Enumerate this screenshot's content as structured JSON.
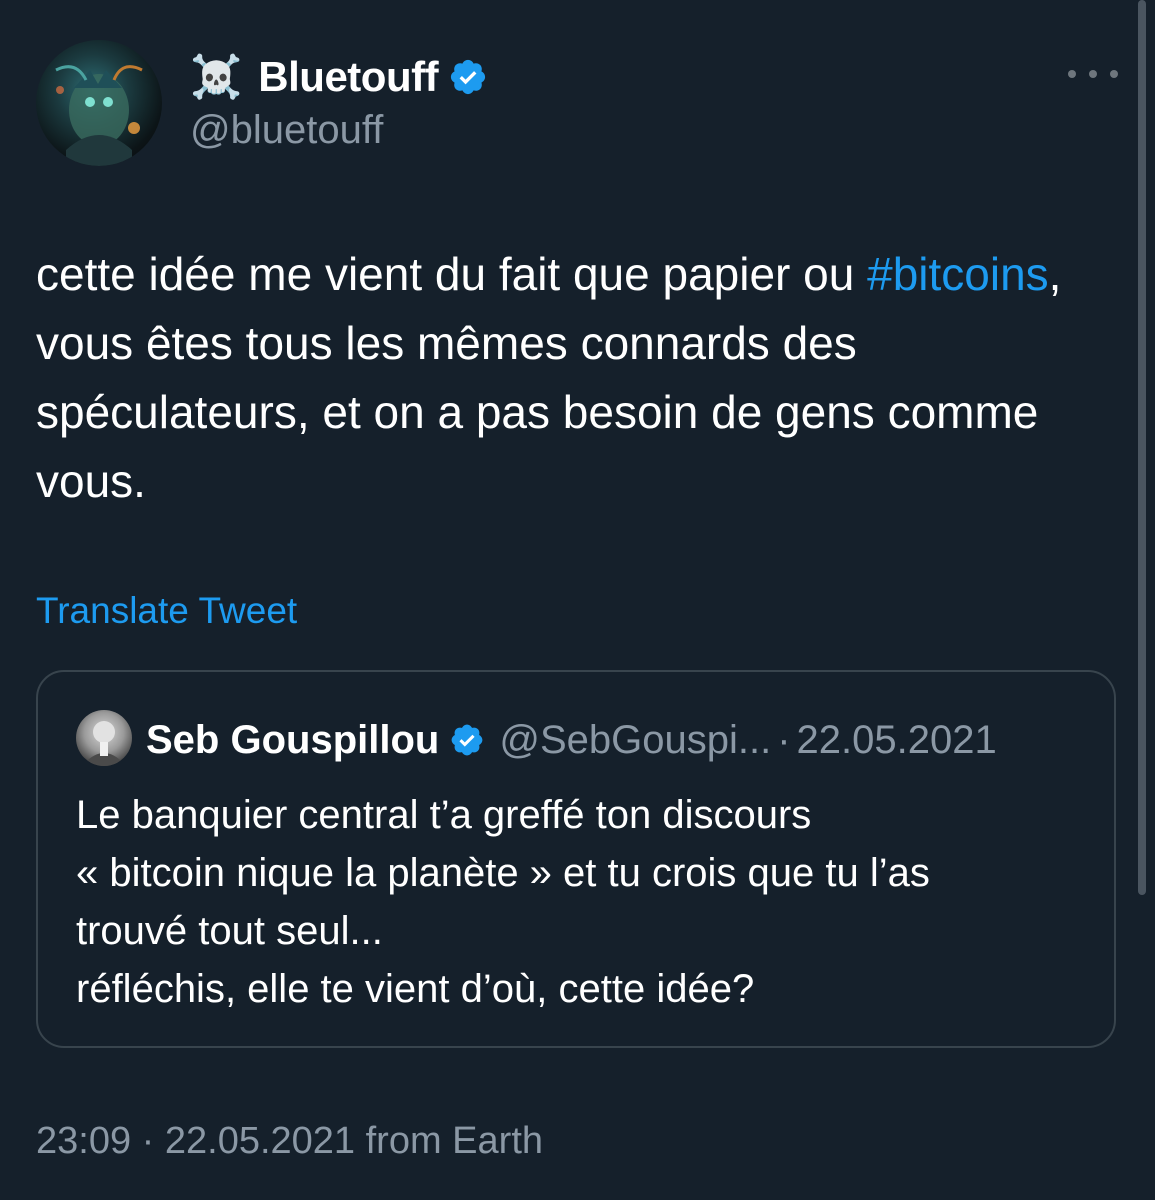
{
  "author": {
    "emoji": "☠️",
    "display_name": "Bluetouff",
    "handle": "@bluetouff",
    "verified_icon": "verified-badge-icon"
  },
  "more_icon": "more-horizontal-icon",
  "tweet": {
    "text_before": "cette idée me vient du fait que papier ou ",
    "hashtag": "#bitcoins",
    "text_after": ", vous êtes tous les mêmes connards des spéculateurs, et on a pas besoin de gens comme vous.",
    "translate_label": "Translate Tweet"
  },
  "quote": {
    "display_name": "Seb Gouspillou",
    "handle": "@SebGouspi...",
    "separator": "·",
    "date": "22.05.2021",
    "lines": [
      "Le banquier central t’a greffé ton discours",
      "« bitcoin nique la planète » et tu crois que tu l’as",
      "trouvé tout seul...",
      "réfléchis, elle te vient d’où, cette idée?"
    ]
  },
  "footer": {
    "time": "23:09",
    "separator": "·",
    "date": "22.05.2021",
    "source": "from Earth"
  },
  "colors": {
    "background": "#15202b",
    "link": "#1d9bf0",
    "secondary_text": "#8b98a5",
    "border": "#38444d"
  }
}
